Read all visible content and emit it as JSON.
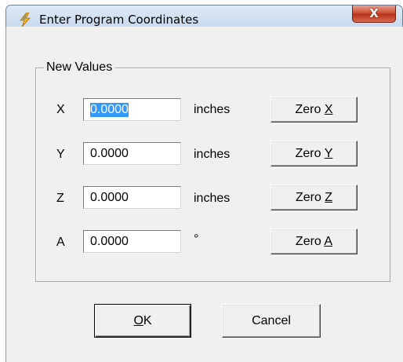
{
  "window": {
    "title": "Enter Program Coordinates",
    "close_label": "X"
  },
  "group": {
    "label": "New Values"
  },
  "rows": [
    {
      "axis": "X",
      "value": "0.0000",
      "unit": "inches",
      "zero_prefix": "Zero ",
      "zero_key": "X"
    },
    {
      "axis": "Y",
      "value": "0.0000",
      "unit": "inches",
      "zero_prefix": "Zero ",
      "zero_key": "Y"
    },
    {
      "axis": "Z",
      "value": "0.0000",
      "unit": "inches",
      "zero_prefix": "Zero ",
      "zero_key": "Z"
    },
    {
      "axis": "A",
      "value": "0.0000",
      "unit": "°",
      "zero_prefix": "Zero ",
      "zero_key": "A"
    }
  ],
  "buttons": {
    "ok_key": "O",
    "ok_rest": "K",
    "cancel": "Cancel"
  },
  "colors": {
    "selection": "#3399ff",
    "dialog_bg": "#f0f0f0",
    "frame": "#c9dbee"
  }
}
